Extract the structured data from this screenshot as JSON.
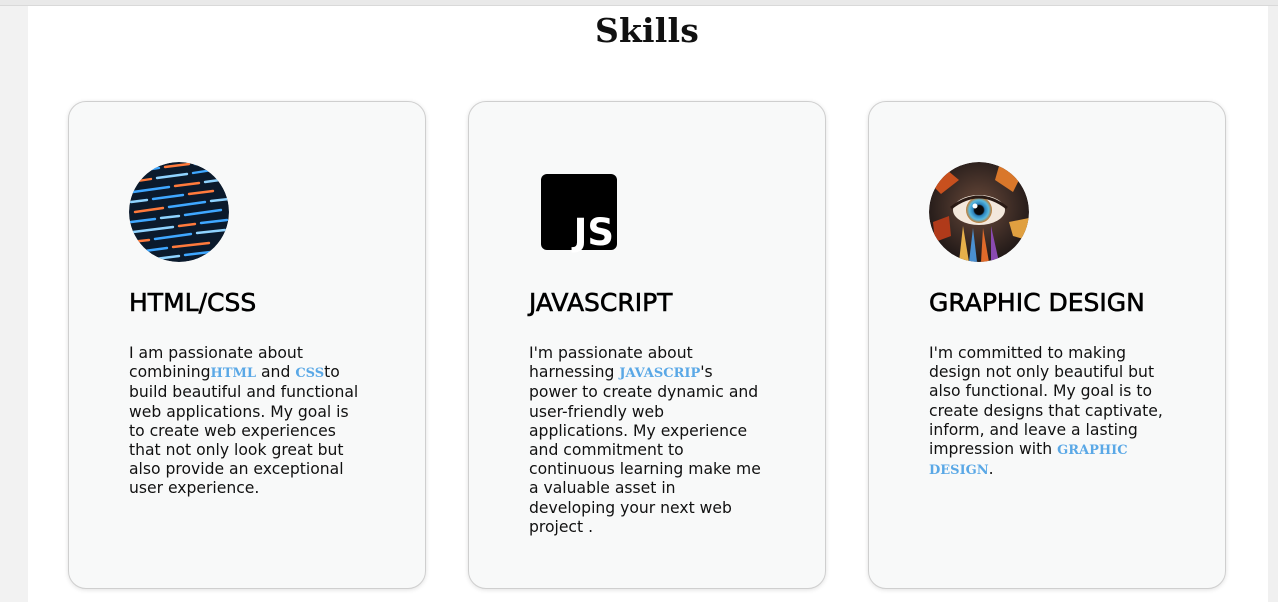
{
  "section_title": "Skills",
  "cards": [
    {
      "title": "HTML/CSS",
      "icon": "code-screen-icon",
      "parts": [
        "I am passionate about combining",
        "HTML",
        " and ",
        "CSS",
        "to build beautiful and functional web applications. My goal is to create web experiences that not only look great but also provide an exceptional user experience."
      ]
    },
    {
      "title": "JAVASCRIPT",
      "icon": "javascript-logo-icon",
      "logo_text": "JS",
      "parts": [
        "I'm passionate about harnessing ",
        "JAVASCRIP",
        "'s power to create dynamic and user-friendly web applications. My experience and commitment to continuous learning make me a valuable asset in developing your next web project ."
      ]
    },
    {
      "title": "GRAPHIC DESIGN",
      "icon": "colorful-eye-icon",
      "parts": [
        "I'm committed to making design not only beautiful but also functional. My goal is to create designs that captivate, inform, and leave a lasting impression with ",
        "GRAPHIC DESIGN",
        "."
      ]
    }
  ],
  "colors": {
    "keyword": "#5aa8e6",
    "card_bg": "#f8f9f9",
    "page_bg": "#ffffff",
    "outer_bg": "#f2f2f2"
  }
}
